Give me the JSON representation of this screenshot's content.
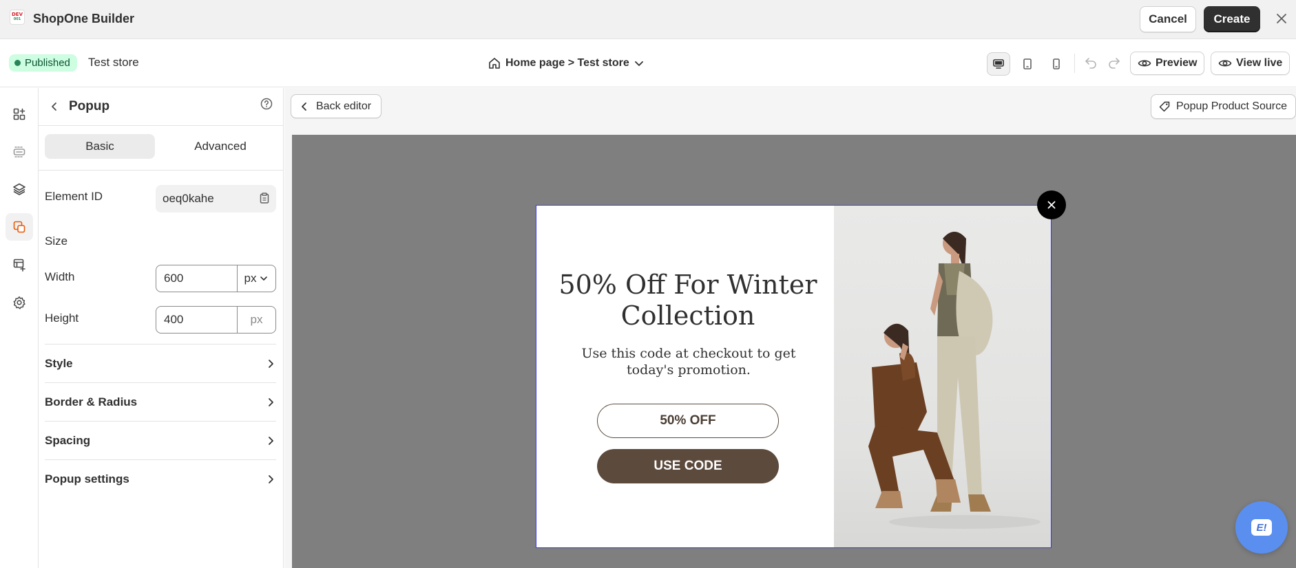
{
  "app": {
    "title": "ShopOne Builder",
    "logo_text_top": "DEV",
    "logo_text_bottom": "001",
    "cancel_label": "Cancel",
    "create_label": "Create"
  },
  "subbar": {
    "status": "Published",
    "store": "Test store",
    "page_selector": "Home page > Test store",
    "preview_label": "Preview",
    "view_live_label": "View live"
  },
  "panel": {
    "title": "Popup",
    "tabs": [
      "Basic",
      "Advanced"
    ],
    "element_id_label": "Element ID",
    "element_id_value": "oeq0kahe",
    "size_label": "Size",
    "width_label": "Width",
    "width_value": "600",
    "width_unit": "px",
    "height_label": "Height",
    "height_value": "400",
    "height_unit": "px",
    "sections": [
      "Style",
      "Border & Radius",
      "Spacing",
      "Popup settings"
    ]
  },
  "canvas": {
    "back_editor_label": "Back editor",
    "product_source_label": "Popup Product Source"
  },
  "popup": {
    "heading": "50% Off For Winter Collection",
    "subtext": "Use this code at checkout to get today's promotion.",
    "code_label": "50% OFF",
    "use_code_label": "USE CODE"
  },
  "chat": {
    "label": "E!"
  },
  "colors": {
    "accent_dark": "#303030",
    "published_bg": "#cdfee1",
    "published_dot": "#29845a",
    "stage_bg": "#7f7f7f",
    "popup_button": "#5c4a3d",
    "rail_active_icon": "#e8590c",
    "chat_fab": "#5a8ff0"
  }
}
